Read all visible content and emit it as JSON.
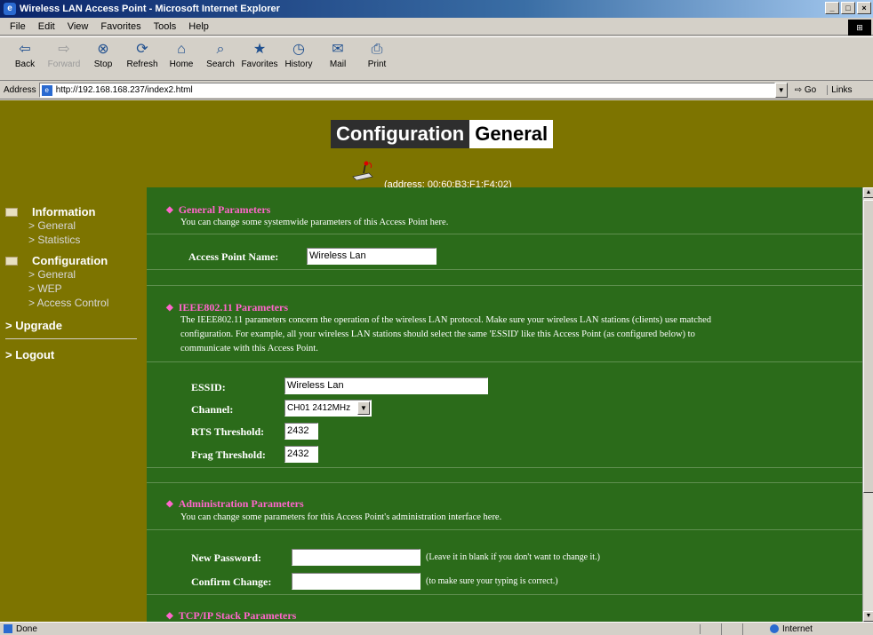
{
  "window": {
    "title": "Wireless LAN Access Point - Microsoft Internet Explorer"
  },
  "menu": [
    "File",
    "Edit",
    "View",
    "Favorites",
    "Tools",
    "Help"
  ],
  "toolbar": {
    "back": "Back",
    "forward": "Forward",
    "stop": "Stop",
    "refresh": "Refresh",
    "home": "Home",
    "search": "Search",
    "favorites": "Favorites",
    "history": "History",
    "mail": "Mail",
    "print": "Print"
  },
  "address": {
    "label": "Address",
    "url": "http://192.168.168.237/index2.html",
    "go": "Go",
    "links": "Links"
  },
  "header": {
    "title_part1": "Configuration",
    "title_part2": "General",
    "mac_address": "(address: 00:60:B3:F1:F4:02)"
  },
  "nav": {
    "information": "Information",
    "info_general": "> General",
    "info_statistics": "> Statistics",
    "configuration": "Configuration",
    "conf_general": "> General",
    "conf_wep": "> WEP",
    "conf_access_control": "> Access Control",
    "upgrade": "> Upgrade",
    "logout": "> Logout"
  },
  "general": {
    "title": "General Parameters",
    "desc": "You can change some systemwide parameters of this Access Point here.",
    "ap_name_label": "Access Point Name:",
    "ap_name_value": "Wireless Lan"
  },
  "ieee": {
    "title": "IEEE802.11 Parameters",
    "desc_line1": "The IEEE802.11 parameters concern the operation of the wireless LAN protocol. Make sure your wireless LAN stations (clients) use matched",
    "desc_line2": "configuration. For example, all your wireless LAN stations should select the same 'ESSID' like this Access Point (as configured below) to",
    "desc_line3": "communicate with this Access Point.",
    "essid_label": "ESSID:",
    "essid_value": "Wireless Lan",
    "channel_label": "Channel:",
    "channel_value": "CH01 2412MHz",
    "rts_label": "RTS Threshold:",
    "rts_value": "2432",
    "frag_label": "Frag Threshold:",
    "frag_value": "2432"
  },
  "admin": {
    "title": "Administration Parameters",
    "desc": "You can change some parameters for this Access Point's administration interface here.",
    "new_password_label": "New Password:",
    "new_password_hint": "(Leave it in blank if you don't want to change it.)",
    "confirm_label": "Confirm Change:",
    "confirm_hint": "(to make sure your typing is correct.)"
  },
  "tcpip": {
    "title": "TCP/IP Stack Parameters"
  },
  "status": {
    "text": "Done",
    "zone": "Internet"
  }
}
